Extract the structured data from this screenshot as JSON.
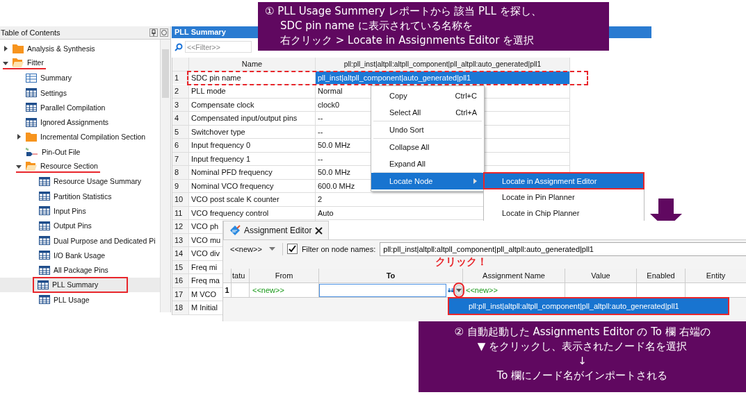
{
  "toc": {
    "title": "Table of Contents",
    "items": [
      {
        "label": "Analysis & Synthesis",
        "kind": "folder",
        "expanded": false,
        "selected": false
      },
      {
        "label": "Fitter",
        "kind": "folder",
        "expanded": true,
        "selected": false,
        "underlined": true,
        "children": [
          {
            "label": "Summary",
            "kind": "summary",
            "selected": false
          },
          {
            "label": "Settings",
            "kind": "table",
            "selected": false
          },
          {
            "label": "Parallel Compilation",
            "kind": "table",
            "selected": false
          },
          {
            "label": "Ignored Assignments",
            "kind": "table",
            "selected": false
          },
          {
            "label": "Incremental Compilation Section",
            "kind": "folder",
            "expanded": false,
            "selected": false
          },
          {
            "label": "Pin-Out File",
            "kind": "pin",
            "selected": false
          },
          {
            "label": "Resource Section",
            "kind": "folder",
            "expanded": true,
            "selected": false,
            "underlined": true,
            "children": [
              {
                "label": "Resource Usage Summary",
                "kind": "table",
                "selected": false
              },
              {
                "label": "Partition Statistics",
                "kind": "table",
                "selected": false
              },
              {
                "label": "Input Pins",
                "kind": "table",
                "selected": false
              },
              {
                "label": "Output Pins",
                "kind": "table",
                "selected": false
              },
              {
                "label": "Dual Purpose and Dedicated Pi",
                "kind": "table",
                "selected": false
              },
              {
                "label": "I/O Bank Usage",
                "kind": "table",
                "selected": false
              },
              {
                "label": "All Package Pins",
                "kind": "table",
                "selected": false
              },
              {
                "label": "PLL Summary",
                "kind": "table",
                "selected": true,
                "boxed": true
              },
              {
                "label": "PLL Usage",
                "kind": "table",
                "selected": false
              }
            ]
          }
        ]
      }
    ]
  },
  "pll_summary": {
    "title": "PLL Summary",
    "filter_placeholder": "<<Filter>>",
    "columns": [
      "Name",
      "pll:pll_inst|altpll:altpll_component|pll_altpll:auto_generated|pll1"
    ],
    "rows": [
      {
        "index": "1",
        "name": "SDC pin name",
        "value": "pll_inst|altpll_component|auto_generated|pll1",
        "selected": true,
        "annotated": true
      },
      {
        "index": "2",
        "name": "PLL mode",
        "value": "Normal",
        "selected": false
      },
      {
        "index": "3",
        "name": "Compensate clock",
        "value": "clock0",
        "selected": false
      },
      {
        "index": "4",
        "name": "Compensated input/output pins",
        "value": "--",
        "selected": false
      },
      {
        "index": "5",
        "name": "Switchover type",
        "value": "--",
        "selected": false
      },
      {
        "index": "6",
        "name": "Input frequency 0",
        "value": "50.0 MHz",
        "selected": false
      },
      {
        "index": "7",
        "name": "Input frequency 1",
        "value": "--",
        "selected": false
      },
      {
        "index": "8",
        "name": "Nominal PFD frequency",
        "value": "50.0 MHz",
        "selected": false
      },
      {
        "index": "9",
        "name": "Nominal VCO frequency",
        "value": "600.0 MHz",
        "selected": false
      },
      {
        "index": "10",
        "name": "VCO post scale K counter",
        "value": "2",
        "selected": false
      },
      {
        "index": "11",
        "name": "VCO frequency control",
        "value": "Auto",
        "selected": false
      },
      {
        "index": "12",
        "name": "VCO ph"
      },
      {
        "index": "13",
        "name": "VCO mu"
      },
      {
        "index": "14",
        "name": "VCO div"
      },
      {
        "index": "15",
        "name": "Freq mi"
      },
      {
        "index": "16",
        "name": "Freq ma"
      },
      {
        "index": "17",
        "name": "M VCO"
      },
      {
        "index": "18",
        "name": "M Initial"
      }
    ]
  },
  "context_menu": {
    "items": [
      {
        "kind": "item",
        "label": "Copy",
        "shortcut": "Ctrl+C",
        "selected": false
      },
      {
        "kind": "item",
        "label": "Select All",
        "shortcut": "Ctrl+A",
        "selected": false
      },
      {
        "kind": "separator"
      },
      {
        "kind": "item",
        "label": "Undo Sort",
        "selected": false
      },
      {
        "kind": "separator"
      },
      {
        "kind": "item",
        "label": "Collapse All",
        "selected": false
      },
      {
        "kind": "item",
        "label": "Expand All",
        "selected": false
      },
      {
        "kind": "separator"
      },
      {
        "kind": "submenu",
        "label": "Locate Node",
        "selected": true
      }
    ],
    "submenu": [
      {
        "label": "Locate in Assignment Editor",
        "selected": true,
        "annotated": true
      },
      {
        "label": "Locate in Pin Planner",
        "selected": false
      },
      {
        "label": "Locate in Chip Planner",
        "selected": false
      }
    ]
  },
  "assignment_editor": {
    "tab": "Assignment Editor",
    "node_dropdown": "<<new>>",
    "filter_checked": true,
    "filter_label": "Filter on node names:",
    "filter_value": "pll:pll_inst|altpll:altpll_component|pll_altpll:auto_generated|pll1",
    "columns": [
      "tatu",
      "From",
      "To",
      "Assignment Name",
      "Value",
      "Enabled",
      "Entity"
    ],
    "row": {
      "index": "1",
      "from": "<<new>>",
      "assignment_name": "<<new>>"
    },
    "dropdown_annotated": true,
    "dropdown_options": [
      {
        "label": "pll:pll_inst|altpll:altpll_component|pll_altpll:auto_generated|pll1",
        "selected": true,
        "annotated": true
      }
    ],
    "click_note": "クリック！"
  },
  "callouts": [
    {
      "kind": "top",
      "lines": [
        "① PLL Usage Summery レポートから 該当 PLL を探し、",
        "SDC pin name に表示されている名称を",
        "右クリック > Locate in Assignments Editor を選択"
      ]
    },
    {
      "kind": "bottom",
      "lines": [
        "② 自動起動した Assignments Editor の To 欄 右端の",
        "▼ をクリックし、表示されたノード名を選択",
        "↓",
        "To 欄にノード名がインポートされる"
      ]
    }
  ]
}
